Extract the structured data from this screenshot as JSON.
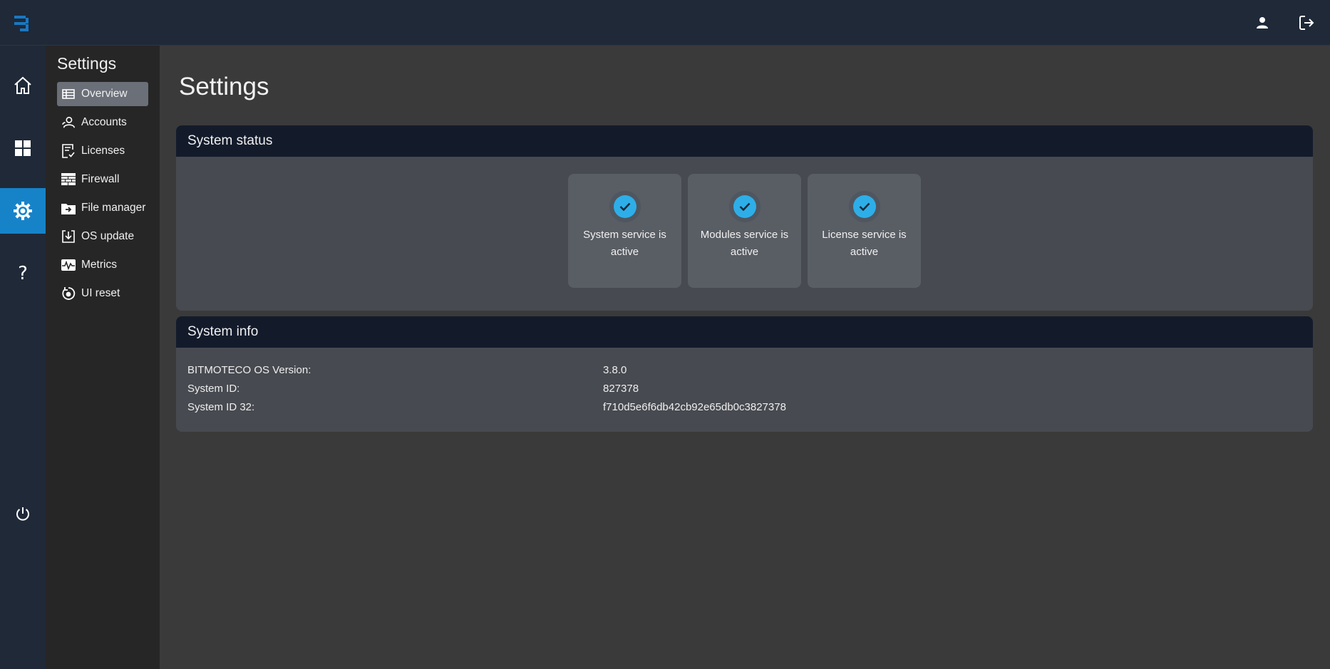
{
  "topbar": {
    "logo_icon": "bitmoteco-logo",
    "user_icon": "user-icon",
    "logout_icon": "logout-icon"
  },
  "rail": {
    "items": [
      {
        "icon": "home-icon",
        "active": false
      },
      {
        "icon": "dashboard-grid-icon",
        "active": false
      },
      {
        "icon": "gear-icon",
        "active": true
      },
      {
        "icon": "help-icon",
        "active": false
      }
    ],
    "power_icon": "power-icon",
    "accent": "#1683c9"
  },
  "subnav": {
    "title": "Settings",
    "items": [
      {
        "label": "Overview",
        "icon": "list-icon",
        "active": true
      },
      {
        "label": "Accounts",
        "icon": "accounts-icon",
        "active": false
      },
      {
        "label": "Licenses",
        "icon": "license-icon",
        "active": false
      },
      {
        "label": "Firewall",
        "icon": "firewall-icon",
        "active": false
      },
      {
        "label": "File manager",
        "icon": "folder-icon",
        "active": false
      },
      {
        "label": "OS update",
        "icon": "download-icon",
        "active": false
      },
      {
        "label": "Metrics",
        "icon": "metrics-icon",
        "active": false
      },
      {
        "label": "UI reset",
        "icon": "reset-icon",
        "active": false
      }
    ]
  },
  "main": {
    "title": "Settings",
    "system_status": {
      "header": "System status",
      "tiles": [
        {
          "label": "System service is active",
          "status": "ok"
        },
        {
          "label": "Modules service is active",
          "status": "ok"
        },
        {
          "label": "License service is active",
          "status": "ok"
        }
      ],
      "ok_color": "#2eaee8"
    },
    "system_info": {
      "header": "System info",
      "rows": [
        {
          "key": "BITMOTECO OS Version:",
          "value": "3.8.0"
        },
        {
          "key": "System ID:",
          "value": "827378"
        },
        {
          "key": "System ID 32:",
          "value": "f710d5e6f6db42cb92e65db0c3827378"
        }
      ]
    }
  }
}
